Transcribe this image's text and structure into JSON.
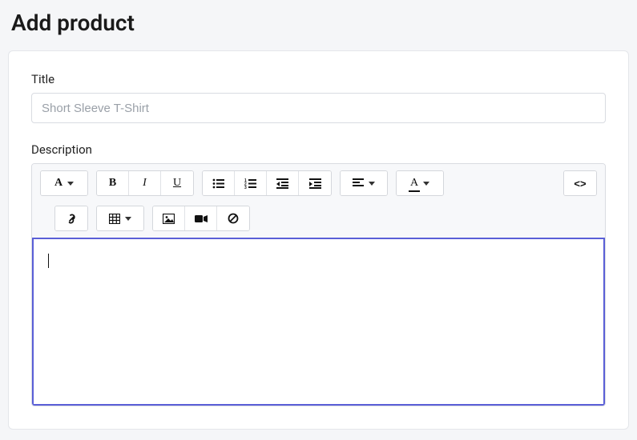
{
  "page": {
    "title": "Add product"
  },
  "fields": {
    "title": {
      "label": "Title",
      "placeholder": "Short Sleeve T-Shirt",
      "value": ""
    },
    "description": {
      "label": "Description",
      "value": ""
    }
  },
  "toolbar": {
    "icons": {
      "paragraph": "paragraph-format-icon",
      "bold": "bold-icon",
      "italic": "italic-icon",
      "underline": "underline-icon",
      "ul": "unordered-list-icon",
      "ol": "ordered-list-icon",
      "outdent": "outdent-icon",
      "indent": "indent-icon",
      "align": "align-icon",
      "textcolor": "text-color-icon",
      "code": "code-view-icon",
      "link": "link-icon",
      "table": "table-icon",
      "image": "image-icon",
      "video": "video-icon",
      "clear": "clear-format-icon"
    }
  }
}
